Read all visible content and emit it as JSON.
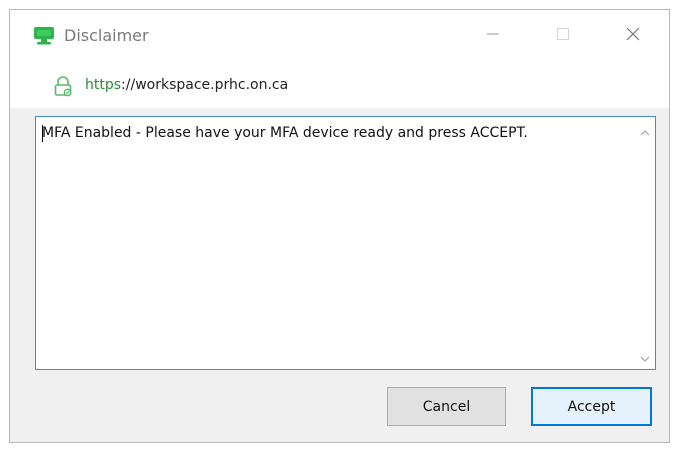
{
  "window": {
    "title": "Disclaimer"
  },
  "url": {
    "scheme": "https",
    "rest": "://workspace.prhc.on.ca"
  },
  "message": {
    "text": "MFA Enabled - Please have your MFA device ready and press ACCEPT."
  },
  "buttons": {
    "cancel_label": "Cancel",
    "accept_label": "Accept"
  },
  "icons": {
    "app": "monitor-icon",
    "lock": "lock-icon",
    "minimize": "minimize-icon",
    "maximize": "maximize-icon",
    "close": "close-icon",
    "scroll_up": "chevron-up-icon",
    "scroll_down": "chevron-down-icon"
  },
  "colors": {
    "accent": "#0078d7",
    "url_scheme": "#2a8a3a",
    "app_icon": "#2eb34a",
    "field_border": "#3c8ad8"
  }
}
